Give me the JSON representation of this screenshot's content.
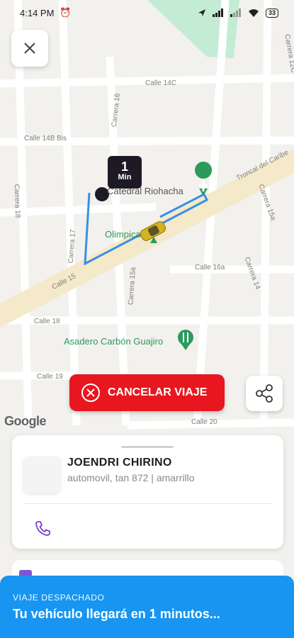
{
  "status_bar": {
    "time": "4:14 PM",
    "alarm_icon": "alarm-icon",
    "battery": "33"
  },
  "map": {
    "eta": {
      "value": "1",
      "unit": "Min"
    },
    "streets": {
      "calle_14c": "Calle 14C",
      "calle_14b_bis": "Calle 14B Bis",
      "carrera_16": "Carrera 16",
      "carrera_18": "Carrera 18",
      "carrera_17": "Carrera 17",
      "carrera_15a": "Carrera 15a",
      "carrera_15a_right": "Carrera 15a",
      "calle_15": "Calle 15",
      "calle_16a": "Calle 16a",
      "carrera_14": "Carrera 14",
      "calle_18": "Calle 18",
      "calle_19": "Calle 19",
      "calle_20": "Calle 20",
      "carrera_12c": "Carrera 12C",
      "troncal": "Troncal del Caribe"
    },
    "pois": {
      "catedral": "Catedral Riohacha",
      "olimpica": "Olimpica",
      "asadero": "Asadero Carbón Guajiro"
    },
    "attribution": "Google"
  },
  "actions": {
    "cancel_label": "CANCELAR VIAJE"
  },
  "driver": {
    "name": "JOENDRI CHIRINO",
    "vehicle": "automovil, tan 872 | amarrillo"
  },
  "banner": {
    "status": "VIAJE DESPACHADO",
    "message": "Tu vehículo llegará en 1 minutos..."
  },
  "colors": {
    "accent_red": "#e8171f",
    "banner_blue": "#1795f0",
    "route_blue": "#3a8ee6",
    "phone_purple": "#7b3fc7"
  }
}
